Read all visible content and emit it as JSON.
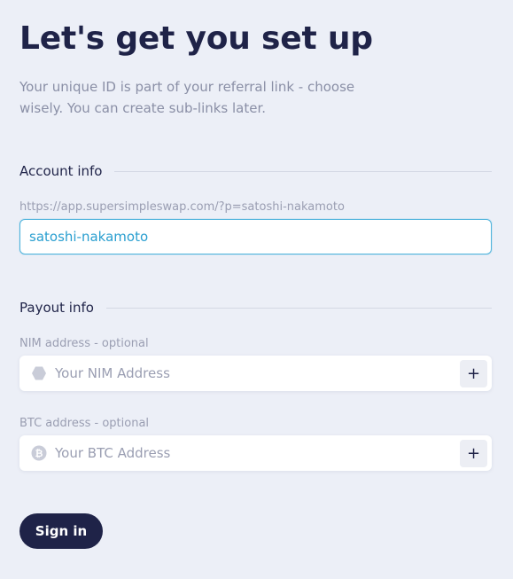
{
  "header": {
    "title": "Let's get you set up",
    "subtitle": "Your unique ID is part of your referral link - choose wisely. You can create sub-links later."
  },
  "account": {
    "section_label": "Account info",
    "link_preview": "https://app.supersimpleswap.com/?p=satoshi-nakamoto",
    "id_value": "satoshi-nakamoto"
  },
  "payout": {
    "section_label": "Payout info",
    "nim": {
      "label": "NIM address - optional",
      "placeholder": "Your NIM Address",
      "add_label": "+"
    },
    "btc": {
      "label": "BTC address - optional",
      "placeholder": "Your BTC Address",
      "add_label": "+"
    }
  },
  "actions": {
    "sign_in_label": "Sign in"
  },
  "colors": {
    "background": "#eceff7",
    "primary": "#1f2348",
    "accent": "#4fb3dc",
    "muted_text": "#9a9eb2"
  },
  "icons": {
    "nim": "hexagon-icon",
    "btc": "bitcoin-icon"
  }
}
